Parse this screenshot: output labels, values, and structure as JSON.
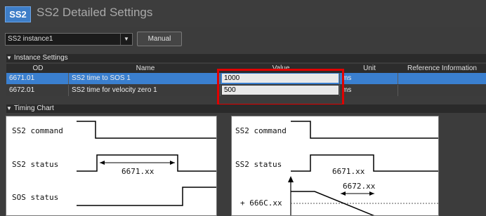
{
  "app": {
    "logo": "SS2",
    "title": "SS2 Detailed Settings"
  },
  "toolbar": {
    "instance_value": "SS2 instance1",
    "manual_label": "Manual"
  },
  "instance_settings": {
    "header": "Instance Settings",
    "columns": [
      "OD",
      "Name",
      "Value",
      "Unit",
      "Reference Information"
    ],
    "rows": [
      {
        "od": "6671.01",
        "name": "SS2 time to SOS 1",
        "value": "1000",
        "unit": "ms",
        "ref": ""
      },
      {
        "od": "6672.01",
        "name": "SS2 time for velocity zero 1",
        "value": "500",
        "unit": "ms",
        "ref": ""
      }
    ]
  },
  "timing_chart": {
    "header": "Timing Chart",
    "left": {
      "command": "SS2 command",
      "status": "SS2 status",
      "sos": "SOS status",
      "dim": "6671.xx"
    },
    "right": {
      "command": "SS2 command",
      "status": "SS2 status",
      "dim1": "6671.xx",
      "dim2": "6672.xx",
      "speed": "+ 666C.xx"
    }
  },
  "colors": {
    "selected_row": "#3a7fcf",
    "highlight": "#e10000",
    "logo": "#3e7ec8"
  }
}
